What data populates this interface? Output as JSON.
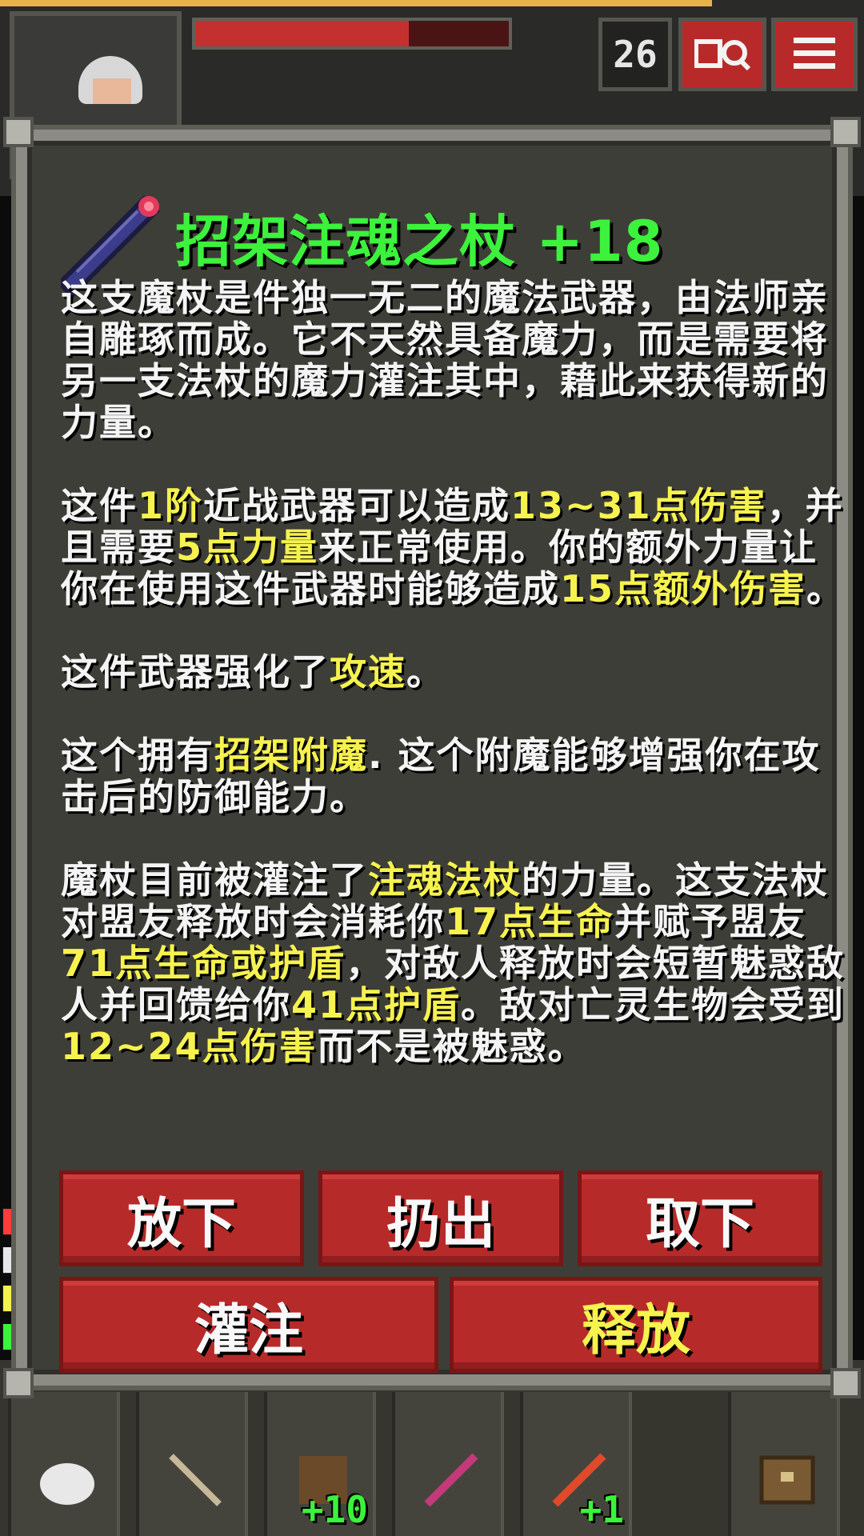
{
  "hud": {
    "hp_fill": 0.68,
    "depth": "26",
    "journal_icon": "journal-icon",
    "menu_icon": "menu-icon",
    "log_colors": [
      "#ff3b3b",
      "#e8e8e8",
      "#f6f24e",
      "#3cf23c"
    ]
  },
  "item": {
    "title": "招架注魂之杖 +18",
    "icon": "wand-icon",
    "description": [
      [
        {
          "t": "这支魔杖是件独一无二的魔法武器，由法师亲自雕琢而成。它不天然具备魔力，而是需要将另一支法杖的魔力灌注其中，藉此来获得新的力量。",
          "h": false
        }
      ],
      [
        {
          "t": "这件",
          "h": false
        },
        {
          "t": "1阶",
          "h": true
        },
        {
          "t": "近战武器可以造成",
          "h": false
        },
        {
          "t": "13~31点伤害",
          "h": true
        },
        {
          "t": "，并且需要",
          "h": false
        },
        {
          "t": "5点力量",
          "h": true
        },
        {
          "t": "来正常使用。你的额外力量让你在使用这件武器时能够造成",
          "h": false
        },
        {
          "t": "15点额外伤害",
          "h": true
        },
        {
          "t": "。",
          "h": false
        }
      ],
      [
        {
          "t": "这件武器强化了",
          "h": false
        },
        {
          "t": "攻速",
          "h": true
        },
        {
          "t": "。",
          "h": false
        }
      ],
      [
        {
          "t": "这个拥有",
          "h": false
        },
        {
          "t": "招架附魔",
          "h": true
        },
        {
          "t": ". 这个附魔能够增强你在攻击后的防御能力。",
          "h": false
        }
      ],
      [
        {
          "t": "魔杖目前被灌注了",
          "h": false
        },
        {
          "t": "注魂法杖",
          "h": true
        },
        {
          "t": "的力量。这支法杖对盟友释放时会消耗你",
          "h": false
        },
        {
          "t": "17点生命",
          "h": true
        },
        {
          "t": "并赋予盟友",
          "h": false
        },
        {
          "t": "71点生命或护盾",
          "h": true
        },
        {
          "t": "，对敌人释放时会短暂魅惑敌人并回馈给你",
          "h": false
        },
        {
          "t": "41点护盾",
          "h": true
        },
        {
          "t": "。敌对亡灵生物会受到",
          "h": false
        },
        {
          "t": "12~24点伤害",
          "h": true
        },
        {
          "t": "而不是被魅惑。",
          "h": false
        }
      ]
    ]
  },
  "actions": {
    "drop": "放下",
    "throw": "扔出",
    "unequip": "取下",
    "imbue": "灌注",
    "zap": "释放"
  },
  "toolbar": {
    "slot3_badge": "+10",
    "slot5_badge": "+1"
  }
}
